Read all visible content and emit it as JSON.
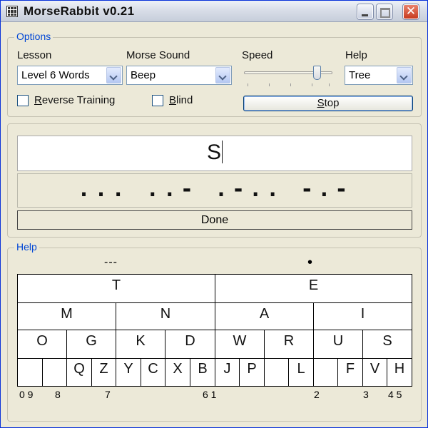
{
  "window": {
    "title": "MorseRabbit v0.21",
    "close_glyph": "✕"
  },
  "options": {
    "group_label": "Options",
    "lesson_label": "Lesson",
    "lesson_value": "Level 6 Words",
    "sound_label": "Morse Sound",
    "sound_value": "Beep",
    "speed_label": "Speed",
    "speed_level": 0.85,
    "help_label": "Help",
    "help_value": "Tree",
    "reverse_prefix": "",
    "reverse_ul": "R",
    "reverse_rest": "everse Training",
    "reverse_checked": false,
    "blind_ul": "B",
    "blind_rest": "lind",
    "blind_checked": false,
    "stop_ul": "S",
    "stop_rest": "top"
  },
  "training": {
    "typed": "S",
    "morse": "... ..- .-.. -.-",
    "status": "Done"
  },
  "help": {
    "group_label": "Help",
    "dash_mark": "---",
    "dot_mark": "•",
    "row1": [
      "T",
      "E"
    ],
    "row2": [
      "M",
      "N",
      "A",
      "I"
    ],
    "row3": [
      "O",
      "G",
      "K",
      "D",
      "W",
      "R",
      "U",
      "S"
    ],
    "row4": [
      "",
      "",
      "Q",
      "Z",
      "Y",
      "C",
      "X",
      "B",
      "J",
      "P",
      "",
      "L",
      "",
      "F",
      "V",
      "H"
    ],
    "numbers": [
      "0 9",
      "8",
      "7",
      "6 1",
      "2",
      "3",
      "4 5"
    ]
  }
}
